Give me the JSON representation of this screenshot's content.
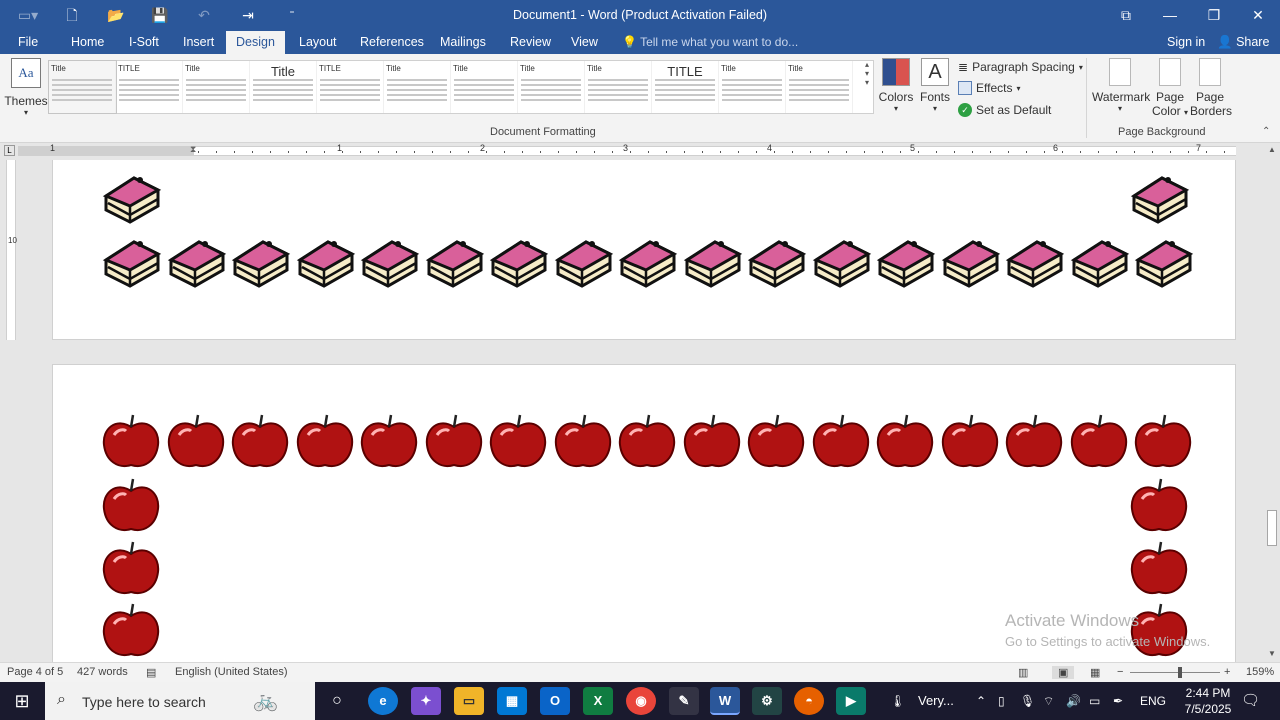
{
  "window": {
    "title": "Document1 - Word (Product Activation Failed)"
  },
  "tabs": {
    "file": "File",
    "home": "Home",
    "isoft": "I-Soft",
    "insert": "Insert",
    "design": "Design",
    "layout": "Layout",
    "references": "References",
    "mailings": "Mailings",
    "review": "Review",
    "view": "View",
    "tell_me": "Tell me what you want to do...",
    "sign_in": "Sign in",
    "share": "Share"
  },
  "ribbon": {
    "themes_label": "Themes",
    "style_thumbs": [
      {
        "title": "Title"
      },
      {
        "title": "TITLE"
      },
      {
        "title": "Title"
      },
      {
        "title": "Title"
      },
      {
        "title": "TITLE"
      },
      {
        "title": "Title"
      },
      {
        "title": "Title"
      },
      {
        "title": "Title"
      },
      {
        "title": "Title"
      },
      {
        "title": "TITLE"
      },
      {
        "title": "Title"
      },
      {
        "title": "Title"
      }
    ],
    "document_formatting_label": "Document Formatting",
    "colors_label": "Colors",
    "fonts_label": "Fonts",
    "paragraph_spacing_label": "Paragraph Spacing",
    "effects_label": "Effects",
    "set_as_default_label": "Set as Default",
    "watermark_label": "Watermark",
    "page_color_label_1": "Page",
    "page_color_label_2": "Color",
    "page_borders_label_1": "Page",
    "page_borders_label_2": "Borders",
    "page_background_label": "Page Background"
  },
  "ruler": {
    "numbers": [
      "1",
      "1",
      "2",
      "3",
      "4",
      "5",
      "6",
      "7"
    ],
    "vertical_number": "10"
  },
  "document": {
    "page4_border_art": "cake",
    "page5_border_art": "apple"
  },
  "activation": {
    "line1": "Activate Windows",
    "line2": "Go to Settings to activate Windows."
  },
  "status": {
    "page": "Page 4 of 5",
    "words": "427 words",
    "language": "English (United States)",
    "zoom": "159%"
  },
  "taskbar": {
    "search_placeholder": "Type here to search",
    "weather_text": "Very...",
    "lang": "ENG",
    "time": "2:44 PM",
    "date": "7/5/2025"
  },
  "colors": {
    "word_blue": "#2b579a",
    "apple_red": "#b01212",
    "cake_pink": "#d9609a",
    "cake_cream": "#f6ecc8"
  }
}
